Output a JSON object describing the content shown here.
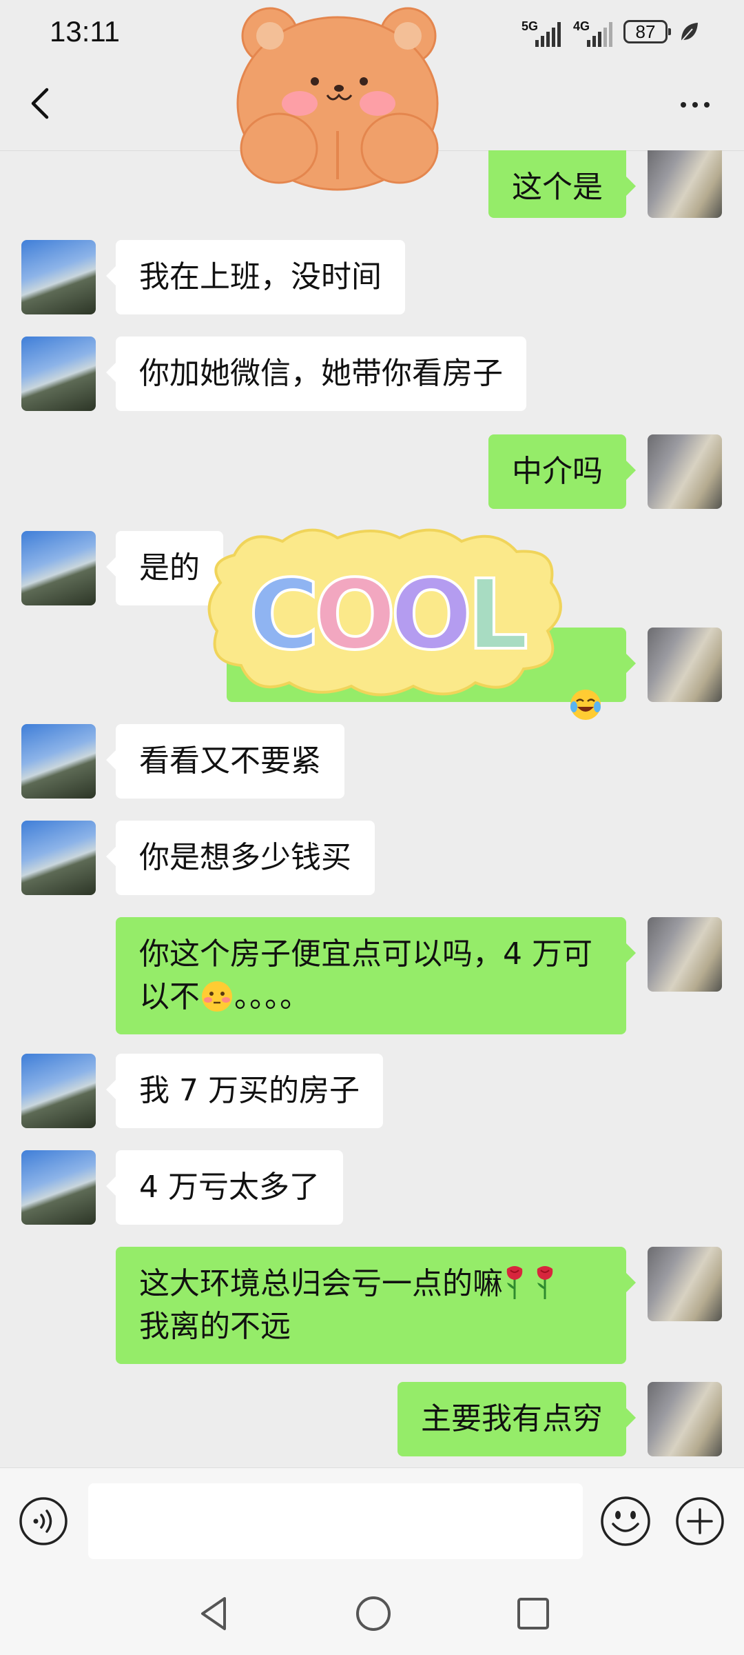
{
  "status_bar": {
    "time": "13:11",
    "signal1_label": "5G",
    "signal2_label": "4G",
    "battery": "87"
  },
  "header": {
    "back_icon": "chevron-left-icon",
    "more_icon": "more-dots-icon"
  },
  "stickers": {
    "bear": "bear-sticker",
    "cool_text": "COOL"
  },
  "messages": [
    {
      "side": "right",
      "text": "这个是"
    },
    {
      "side": "left",
      "text": "我在上班，没时间"
    },
    {
      "side": "left",
      "text": "你加她微信，她带你看房子"
    },
    {
      "side": "right",
      "text": "中介吗"
    },
    {
      "side": "left",
      "text": "是的"
    },
    {
      "side": "right",
      "text": "",
      "emoji": "laugh-cry-emoji"
    },
    {
      "side": "left",
      "text": "看看又不要紧"
    },
    {
      "side": "left",
      "text": "你是想多少钱买"
    },
    {
      "side": "right",
      "text_line1": "你这个房子便宜点可以吗，4 万可",
      "text_line2_before_emoji": "以不",
      "text_line2_after_emoji": "。。。。",
      "emoji": "embarrassed-emoji"
    },
    {
      "side": "left",
      "text": "我 7 万买的房子"
    },
    {
      "side": "left",
      "text": "4 万亏太多了"
    },
    {
      "side": "right",
      "text_line1": "这大环境总归会亏一点的嘛",
      "text_line2": "我离的不远",
      "emoji": "rose-emoji"
    },
    {
      "side": "right",
      "text": "主要我有点穷"
    }
  ],
  "input_bar": {
    "voice_icon": "voice-icon",
    "emoji_icon": "emoji-icon",
    "plus_icon": "plus-icon",
    "placeholder": ""
  },
  "nav_bar": {
    "back": "nav-back-icon",
    "home": "nav-home-icon",
    "recent": "nav-recent-icon"
  }
}
